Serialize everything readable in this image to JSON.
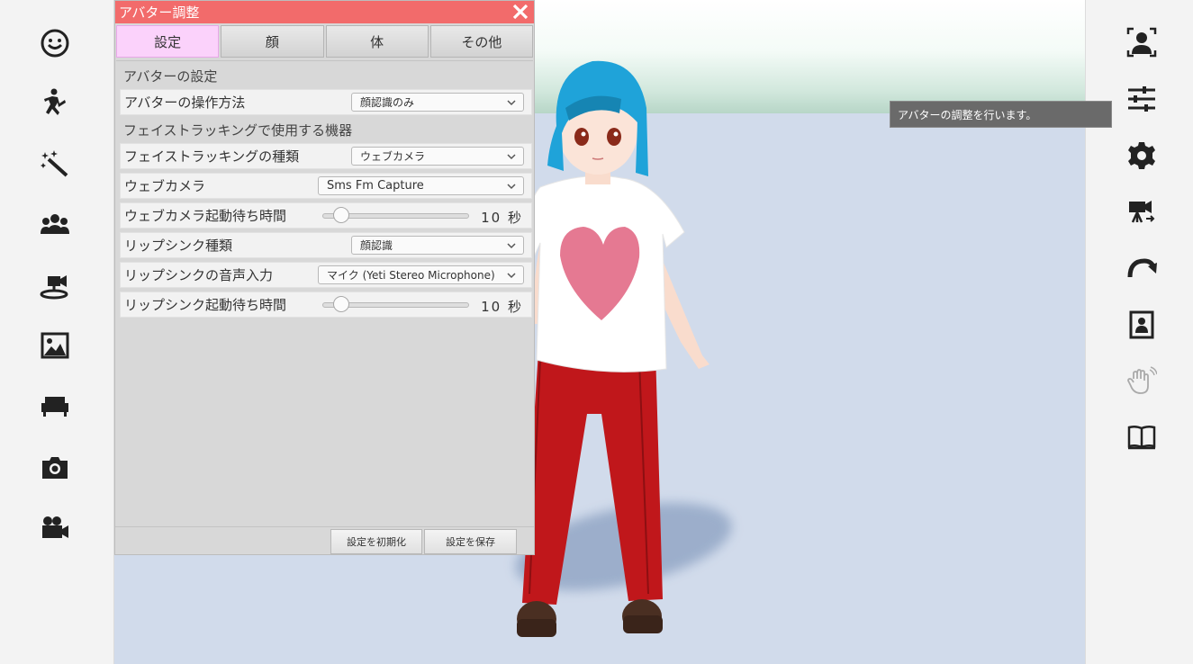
{
  "panel": {
    "title": "アバター調整",
    "tabs": [
      {
        "label": "設定",
        "active": true
      },
      {
        "label": "顔",
        "active": false
      },
      {
        "label": "体",
        "active": false
      },
      {
        "label": "その他",
        "active": false
      }
    ],
    "sections": {
      "avatar_settings": "アバターの設定",
      "face_tracking_devices": "フェイストラッキングで使用する機器"
    },
    "rows": {
      "operation_method": {
        "label": "アバターの操作方法",
        "value": "顔認識のみ"
      },
      "face_tracking_type": {
        "label": "フェイストラッキングの種類",
        "value": "ウェブカメラ"
      },
      "webcam": {
        "label": "ウェブカメラ",
        "value": "Sms Fm Capture"
      },
      "webcam_wait": {
        "label": "ウェブカメラ起動待ち時間",
        "value": "10",
        "unit": "秒",
        "fraction": 0.13
      },
      "lipsync_type": {
        "label": "リップシンク種類",
        "value": "顔認識"
      },
      "lipsync_input": {
        "label": "リップシンクの音声入力",
        "value": "マイク (Yeti Stereo Microphone)"
      },
      "lipsync_wait": {
        "label": "リップシンク起動待ち時間",
        "value": "10",
        "unit": "秒",
        "fraction": 0.13
      }
    },
    "footer": {
      "reset_label": "設定を初期化",
      "save_label": "設定を保存"
    }
  },
  "tooltip": "アバターの調整を行います。",
  "left_sidebar": [
    "face-icon",
    "dance-icon",
    "magic-wand-icon",
    "people-icon",
    "camera-stand-icon",
    "image-icon",
    "sofa-icon",
    "camera-icon",
    "video-camera-icon"
  ],
  "right_sidebar": [
    "face-tracking-icon",
    "sliders-icon",
    "gear-icon",
    "camera-switch-icon",
    "redo-icon",
    "portrait-icon",
    "wave-hand-icon",
    "book-icon"
  ],
  "colors": {
    "title_bar": "#f26b6b",
    "active_tab": "#fbd2fb",
    "hair": "#1fa3d9",
    "shirt_heart": "#e26a86",
    "pants": "#c0171b"
  }
}
